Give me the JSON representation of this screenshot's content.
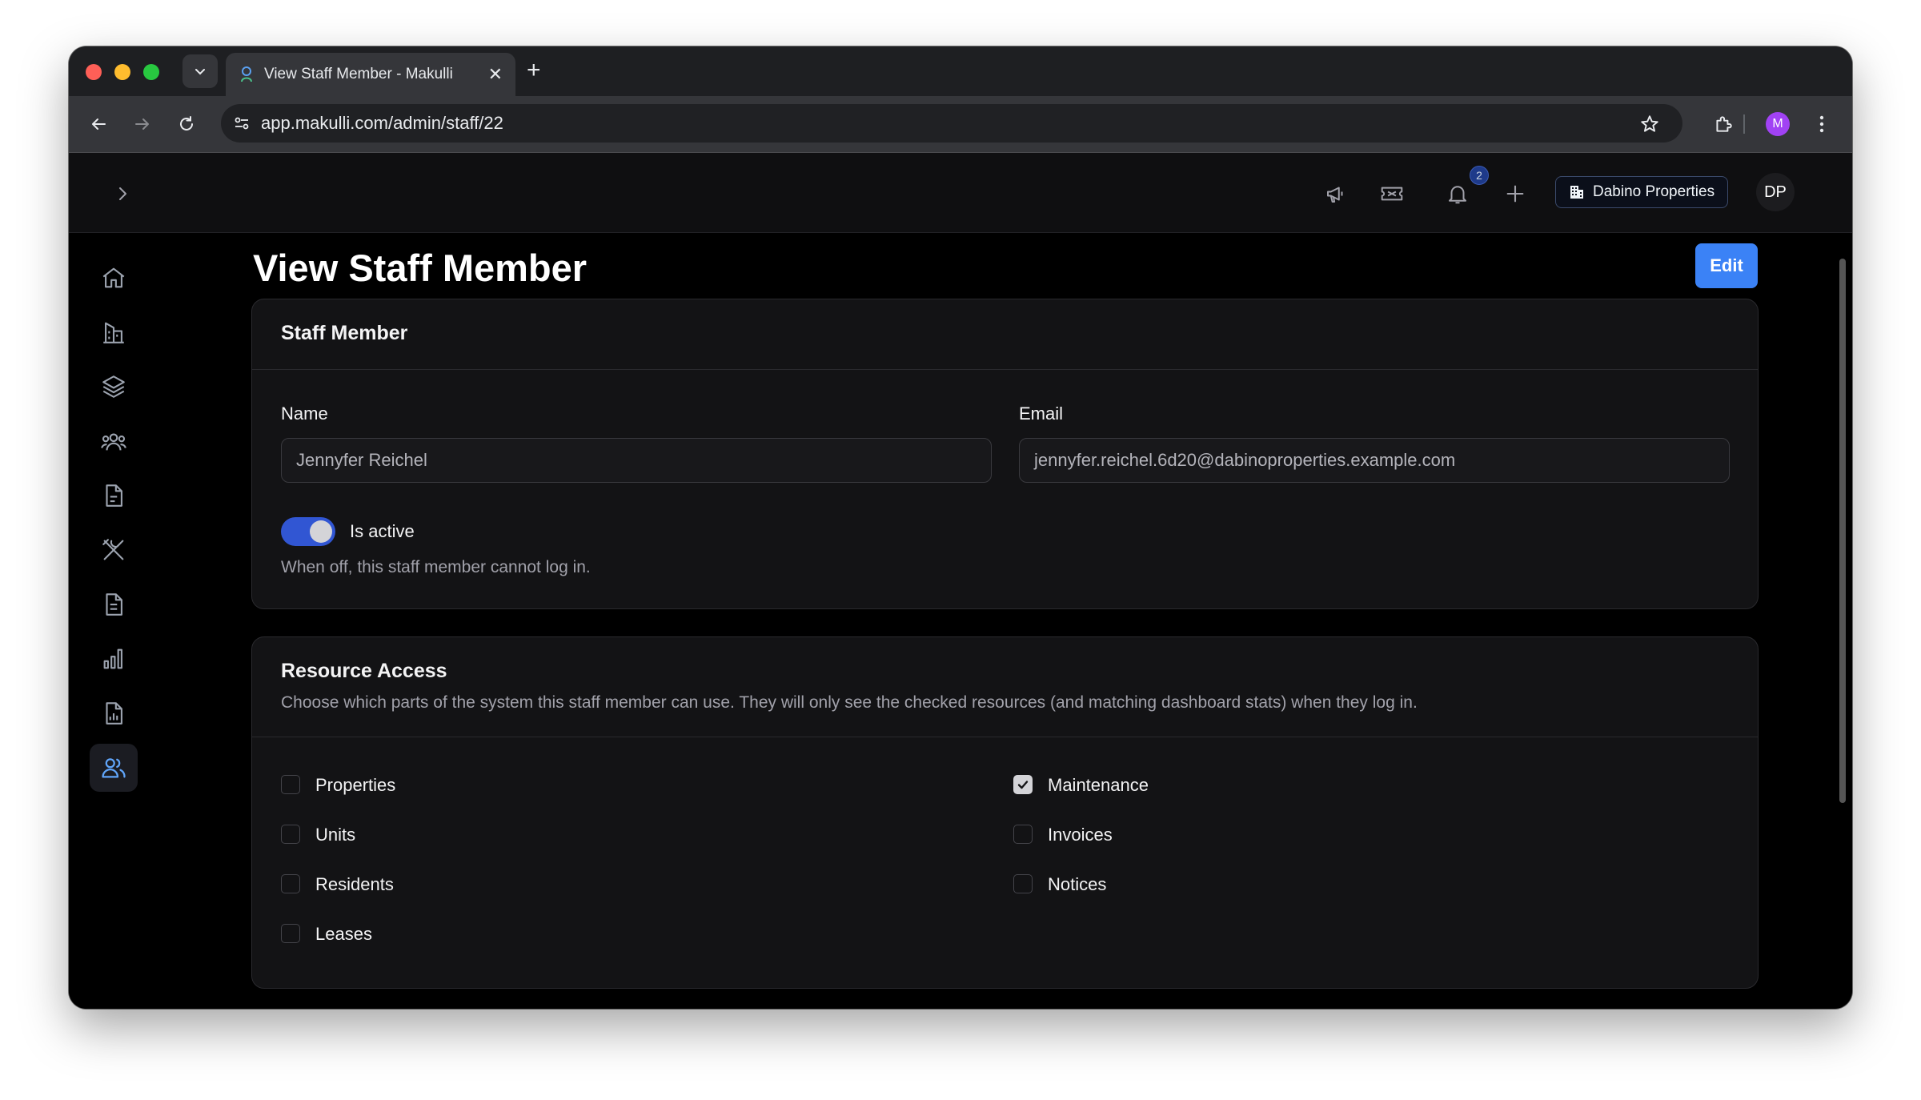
{
  "browser": {
    "tab_title": "View Staff Member - Makulli",
    "url": "app.makulli.com/admin/staff/22",
    "profile_initial": "M"
  },
  "header": {
    "notification_count": "2",
    "tenant_name": "Dabino Properties",
    "user_initials": "DP"
  },
  "sidebar": {
    "items": [
      {
        "icon": "home-icon"
      },
      {
        "icon": "building-icon"
      },
      {
        "icon": "layers-icon"
      },
      {
        "icon": "residents-icon"
      },
      {
        "icon": "document-icon"
      },
      {
        "icon": "tools-icon"
      },
      {
        "icon": "invoice-icon"
      },
      {
        "icon": "bar-chart-icon"
      },
      {
        "icon": "report-icon"
      },
      {
        "icon": "users-icon",
        "active": true
      }
    ]
  },
  "page": {
    "title": "View Staff Member",
    "edit_label": "Edit"
  },
  "staff_card": {
    "title": "Staff Member",
    "name_label": "Name",
    "name_value": "Jennyfer Reichel",
    "email_label": "Email",
    "email_value": "jennyfer.reichel.6d20@dabinoproperties.example.com",
    "active_label": "Is active",
    "active_on": true,
    "active_help": "When off, this staff member cannot log in."
  },
  "access_card": {
    "title": "Resource Access",
    "description": "Choose which parts of the system this staff member can use. They will only see the checked resources (and matching dashboard stats) when they log in.",
    "left": [
      {
        "label": "Properties",
        "checked": false
      },
      {
        "label": "Units",
        "checked": false
      },
      {
        "label": "Residents",
        "checked": false
      },
      {
        "label": "Leases",
        "checked": false
      }
    ],
    "right": [
      {
        "label": "Maintenance",
        "checked": true
      },
      {
        "label": "Invoices",
        "checked": false
      },
      {
        "label": "Notices",
        "checked": false
      }
    ]
  },
  "colors": {
    "accent": "#3b82f6",
    "toggle_on": "#3156d3",
    "card_bg": "#131315"
  }
}
